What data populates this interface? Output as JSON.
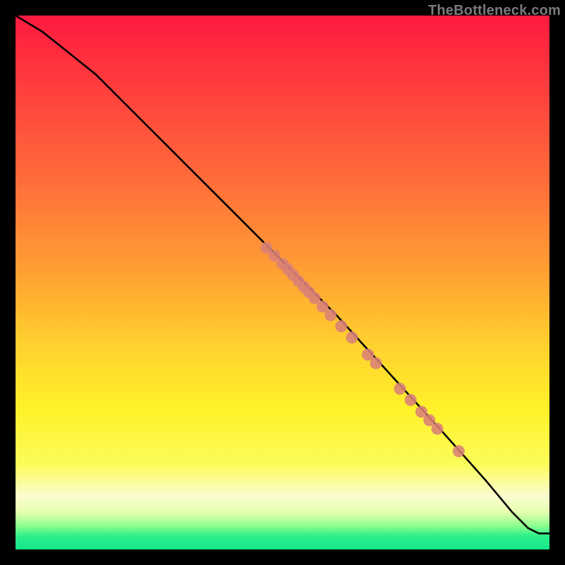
{
  "watermark": "TheBottleneck.com",
  "colors": {
    "line": "#000000",
    "marker_fill": "#d98177",
    "marker_stroke": "#b76a60"
  },
  "chart_data": {
    "type": "line",
    "title": "",
    "xlabel": "",
    "ylabel": "",
    "xlim": [
      0,
      100
    ],
    "ylim": [
      0,
      100
    ],
    "grid": false,
    "legend": false,
    "series": [
      {
        "name": "curve",
        "x": [
          0,
          5,
          10,
          15,
          20,
          30,
          40,
          50,
          60,
          70,
          80,
          88,
          93,
          96,
          98,
          100
        ],
        "y": [
          100,
          97,
          93,
          89,
          84,
          74,
          64,
          54,
          44,
          33,
          22,
          13,
          7,
          4,
          3,
          3
        ]
      }
    ],
    "markers": [
      {
        "x": 47.0,
        "y": 56.5
      },
      {
        "x": 48.5,
        "y": 55.0
      },
      {
        "x": 50.0,
        "y": 53.5
      },
      {
        "x": 51.0,
        "y": 52.5
      },
      {
        "x": 52.0,
        "y": 51.4
      },
      {
        "x": 53.0,
        "y": 50.3
      },
      {
        "x": 54.0,
        "y": 49.2
      },
      {
        "x": 55.0,
        "y": 48.2
      },
      {
        "x": 56.0,
        "y": 47.1
      },
      {
        "x": 57.5,
        "y": 45.5
      },
      {
        "x": 59.0,
        "y": 43.9
      },
      {
        "x": 61.0,
        "y": 41.8
      },
      {
        "x": 63.0,
        "y": 39.7
      },
      {
        "x": 66.0,
        "y": 36.5
      },
      {
        "x": 67.5,
        "y": 34.9
      },
      {
        "x": 72.0,
        "y": 30.1
      },
      {
        "x": 74.0,
        "y": 28.0
      },
      {
        "x": 76.0,
        "y": 25.8
      },
      {
        "x": 77.5,
        "y": 24.2
      },
      {
        "x": 79.0,
        "y": 22.6
      },
      {
        "x": 83.0,
        "y": 18.4
      }
    ]
  }
}
